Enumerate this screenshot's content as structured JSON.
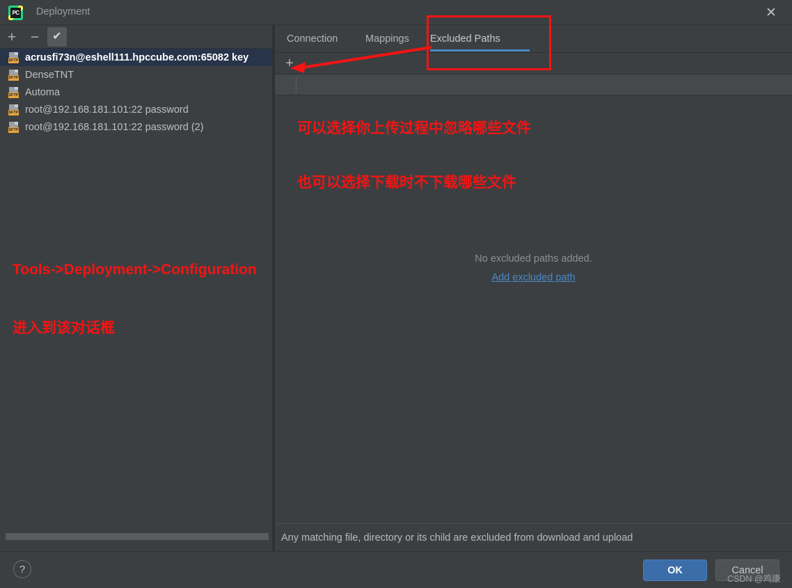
{
  "window": {
    "title": "Deployment",
    "logo_text": "PC",
    "logo_icon": "pycharm-logo-icon",
    "close_icon": "✕"
  },
  "left_panel": {
    "toolbar": {
      "add_icon": "+",
      "remove_icon": "−",
      "default_icon": "✔"
    },
    "items": [
      {
        "label": "acrusfi73n@eshell111.hpccube.com:65082 key",
        "badge": "SFTP",
        "selected": true
      },
      {
        "label": "DenseTNT",
        "badge": "SFTP",
        "selected": false
      },
      {
        "label": "Automa",
        "badge": "SFTP",
        "selected": false
      },
      {
        "label": "root@192.168.181.101:22 password",
        "badge": "SFTP",
        "selected": false
      },
      {
        "label": "root@192.168.181.101:22 password (2)",
        "badge": "SFTP",
        "selected": false
      }
    ]
  },
  "right_panel": {
    "tabs": [
      {
        "label": "Connection",
        "active": false
      },
      {
        "label": "Mappings",
        "active": false
      },
      {
        "label": "Excluded Paths",
        "active": true
      }
    ],
    "toolbar": {
      "add_icon": "+"
    },
    "empty_state": {
      "message": "No excluded paths added.",
      "link": "Add excluded path"
    },
    "status_text": "Any matching file, directory or its child are excluded from download and upload"
  },
  "bottom_bar": {
    "help_icon": "?",
    "ok_label": "OK",
    "cancel_label": "Cancel"
  },
  "annotations": {
    "right_line1": "可以选择你上传过程中忽略哪些文件",
    "right_line2": "也可以选择下载时不下载哪些文件",
    "left_line1": "Tools->Deployment->Configuration",
    "left_line2": "进入到该对话框"
  },
  "watermark": "CSDN @鸡康",
  "colors": {
    "background": "#3c3f41",
    "selection": "#27344a",
    "accent_blue": "#4a88c7",
    "ok_button": "#3b6ea8",
    "annotation_red": "#f41414",
    "sftp_badge": "#e8a33d"
  }
}
